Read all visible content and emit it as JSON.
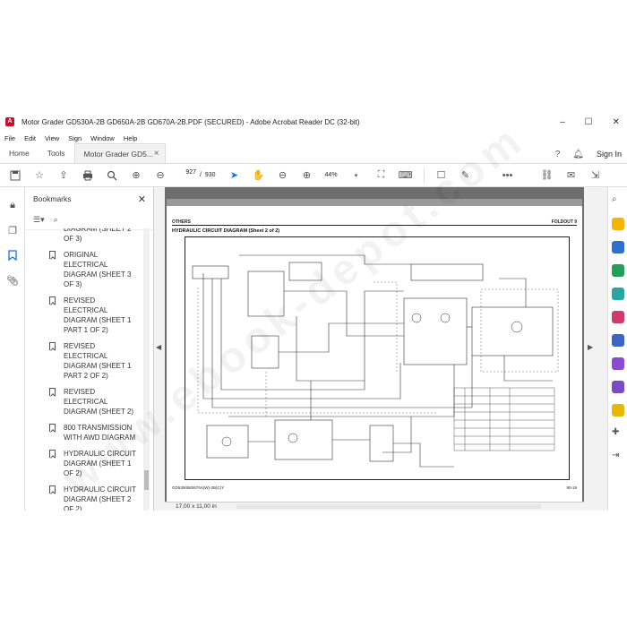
{
  "window": {
    "title": "Motor Grader GD530A-2B GD650A-2B GD670A-2B.PDF (SECURED) - Adobe Acrobat Reader DC (32-bit)",
    "minimize": "–",
    "maximize": "☐",
    "close": "✕"
  },
  "menu": [
    "File",
    "Edit",
    "View",
    "Sign",
    "Window",
    "Help"
  ],
  "tabs": {
    "home": "Home",
    "tools": "Tools",
    "doc": "Motor Grader GD5...",
    "close": "×"
  },
  "account": {
    "signin": "Sign In"
  },
  "toolbar": {
    "page_current": "927",
    "page_sep": "/",
    "page_total": "930",
    "zoom": "44%"
  },
  "bookmarks": {
    "title": "Bookmarks",
    "items": [
      "DIAGRAM (SHEET 2 OF 3)",
      "ORIGINAL ELECTRICAL DIAGRAM (SHEET 3 OF 3)",
      "REVISED ELECTRICAL DIAGRAM (SHEET 1 PART 1 OF 2)",
      "REVISED ELECTRICAL DIAGRAM (SHEET 1 PART 2 OF 2)",
      "REVISED ELECTRICAL DIAGRAM (SHEET 2)",
      "800 TRANSMISSION WITH AWD DIAGRAM",
      "HYDRAULIC CIRCUIT DIAGRAM (SHEET 1 OF 2)",
      "HYDRAULIC CIRCUIT DIAGRAM (SHEET 2 OF 2)"
    ]
  },
  "page": {
    "header_left": "OTHERS",
    "header_right": "FOLDOUT 9",
    "title": "HYDRAULIC CIRCUIT DIAGRAM (Sheet 2 of 2)",
    "footer_left": "GD530/650/670A(W)-2B(C)Y",
    "footer_right": "90-19"
  },
  "status": {
    "size": "17,00 x 11,00 in"
  },
  "colors": {
    "accent": "#1473e6",
    "acrobat_red": "#c8102e"
  }
}
